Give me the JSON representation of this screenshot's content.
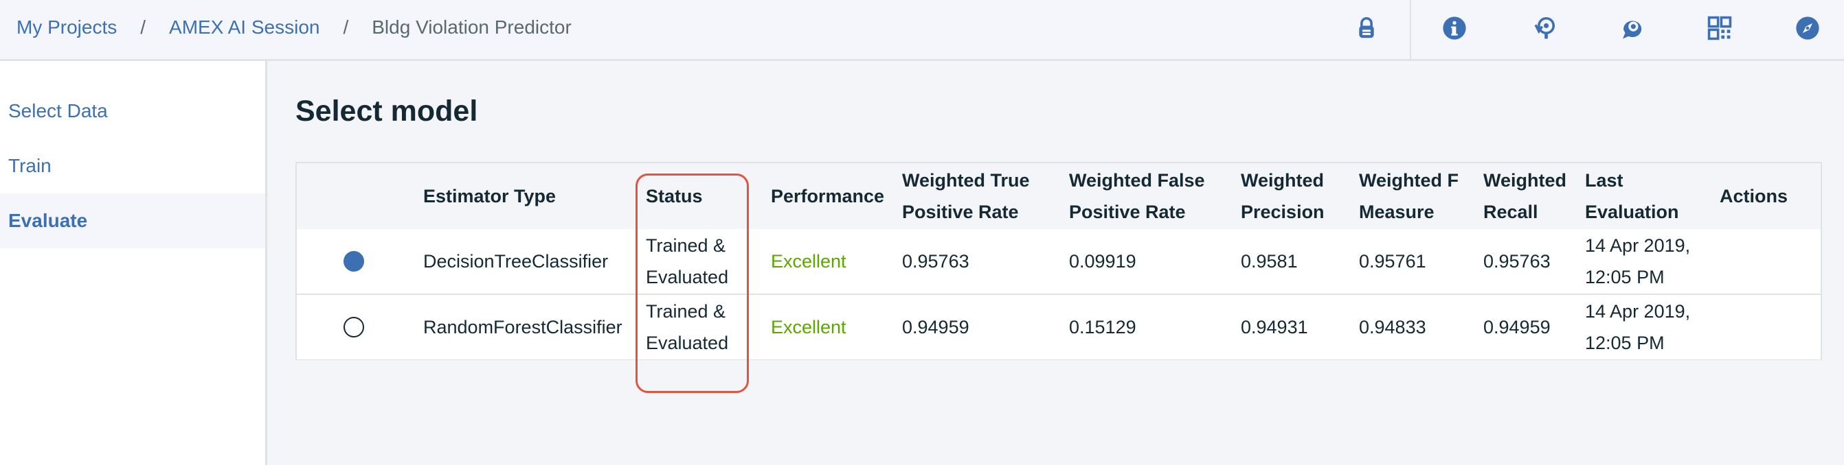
{
  "breadcrumb": {
    "items": [
      "My Projects",
      "AMEX AI Session",
      "Bldg Violation Predictor"
    ],
    "separator": "/"
  },
  "header_icons": [
    "lock-icon",
    "info-icon",
    "history-icon",
    "comment-icon",
    "qr-code-icon",
    "compass-icon"
  ],
  "sidebar": {
    "items": [
      {
        "label": "Select Data",
        "active": false
      },
      {
        "label": "Train",
        "active": false
      },
      {
        "label": "Evaluate",
        "active": true
      }
    ]
  },
  "main": {
    "title": "Select model",
    "table": {
      "columns": [
        "Estimator Type",
        "Status",
        "Performance",
        "Weighted True Positive Rate",
        "Weighted False Positive Rate",
        "Weighted Precision",
        "Weighted F Measure",
        "Weighted Recall",
        "Last Evaluation",
        "Actions"
      ],
      "rows": [
        {
          "selected": true,
          "estimator": "DecisionTreeClassifier",
          "status": "Trained & Evaluated",
          "performance": "Excellent",
          "wtpr": "0.95763",
          "wfpr": "0.09919",
          "precision": "0.9581",
          "f_measure": "0.95761",
          "recall": "0.95763",
          "last_eval": "14 Apr 2019, 12:05 PM",
          "actions": ""
        },
        {
          "selected": false,
          "estimator": "RandomForestClassifier",
          "status": "Trained & Evaluated",
          "performance": "Excellent",
          "wtpr": "0.94959",
          "wfpr": "0.15129",
          "precision": "0.94931",
          "f_measure": "0.94833",
          "recall": "0.94959",
          "last_eval": "14 Apr 2019, 12:05 PM",
          "actions": ""
        }
      ]
    }
  },
  "colors": {
    "link": "#3d70b2",
    "excellent": "#5aa700",
    "highlight": "#e0553f",
    "radio_selected": "#3d70b2"
  }
}
